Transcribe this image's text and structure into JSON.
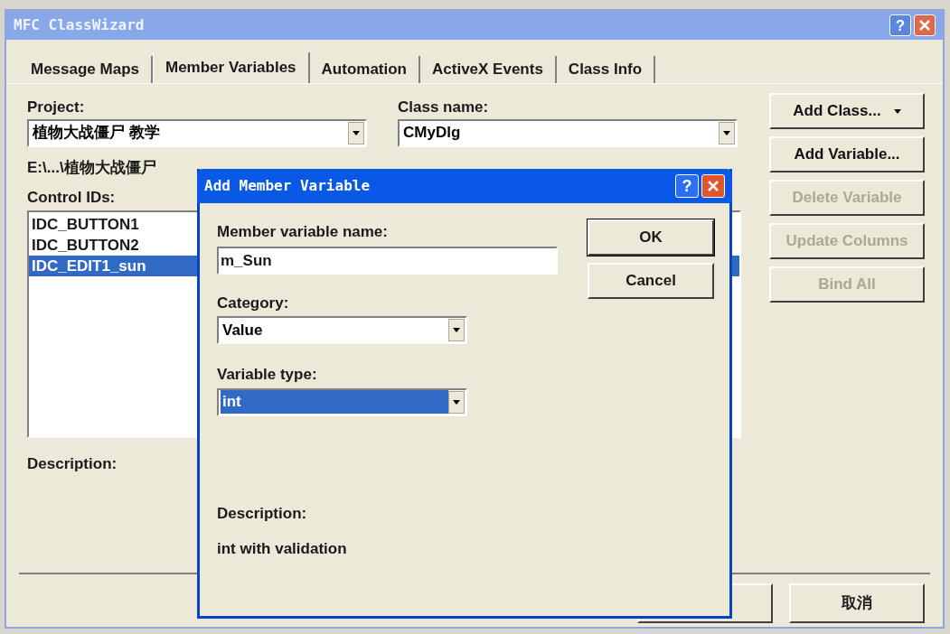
{
  "window": {
    "title": "MFC ClassWizard",
    "help": "?"
  },
  "tabs": [
    {
      "label": "Message Maps",
      "selected": false
    },
    {
      "label": "Member Variables",
      "selected": true
    },
    {
      "label": "Automation",
      "selected": false
    },
    {
      "label": "ActiveX Events",
      "selected": false
    },
    {
      "label": "Class Info",
      "selected": false
    }
  ],
  "project": {
    "label": "Project:",
    "value": "植物大战僵尸 教学"
  },
  "class_name": {
    "label": "Class name:",
    "value": "CMyDlg"
  },
  "path": "E:\\...\\植物大战僵尸",
  "control_ids": {
    "label": "Control IDs:",
    "items": [
      {
        "text": "IDC_BUTTON1",
        "selected": false
      },
      {
        "text": "IDC_BUTTON2",
        "selected": false
      },
      {
        "text": "IDC_EDIT1_sun",
        "selected": true
      }
    ]
  },
  "description_label": "Description:",
  "side_buttons": [
    {
      "label": "Add Class...",
      "dropdown": true,
      "disabled": false
    },
    {
      "label": "Add Variable...",
      "dropdown": false,
      "disabled": false
    },
    {
      "label": "Delete Variable",
      "dropdown": false,
      "disabled": true
    },
    {
      "label": "Update Columns",
      "dropdown": false,
      "disabled": true
    },
    {
      "label": "Bind All",
      "dropdown": false,
      "disabled": true
    }
  ],
  "cancel_button": "取消",
  "dialog": {
    "title": "Add Member Variable",
    "help": "?",
    "name": {
      "label": "Member variable name:",
      "value": "m_Sun"
    },
    "category": {
      "label": "Category:",
      "value": "Value",
      "selected": false
    },
    "variable_type": {
      "label": "Variable type:",
      "value": "int",
      "selected": true
    },
    "buttons": [
      {
        "label": "OK",
        "default": true
      },
      {
        "label": "Cancel",
        "default": false
      }
    ],
    "description": {
      "label": "Description:",
      "text": "int with validation"
    }
  }
}
